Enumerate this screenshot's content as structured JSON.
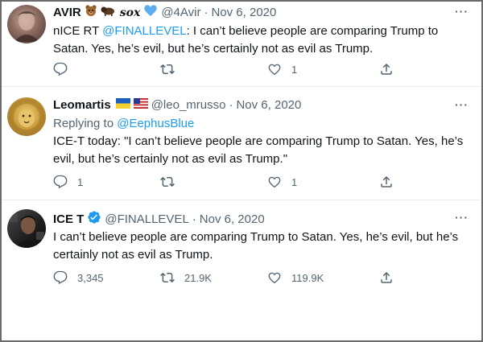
{
  "tweets": [
    {
      "display_name": "AVIR",
      "name_suffix": "sox",
      "handle": "@4Avir",
      "date": "Nov 6, 2020",
      "body_prefix": "nICE RT ",
      "body_mention": "@FINALLEVEL",
      "body_rest": ": I can’t believe people are comparing Trump to Satan.  Yes, he’s evil, but he’s certainly not as evil as Trump.",
      "replies": "",
      "retweets": "",
      "likes": "1"
    },
    {
      "display_name": "Leomartis",
      "handle": "@leo_mrusso",
      "date": "Nov 6, 2020",
      "replying_label": "Replying to ",
      "replying_mention": "@EephusBlue",
      "body": "ICE-T today: \"I can’t believe people are comparing Trump to Satan.  Yes, he’s evil, but he’s certainly not as evil as Trump.\"",
      "replies": "1",
      "retweets": "",
      "likes": "1"
    },
    {
      "display_name": "ICE T",
      "handle": "@FINALLEVEL",
      "date": "Nov 6, 2020",
      "body": "I can’t believe people are comparing Trump to Satan.  Yes, he’s evil, but he’s certainly not as evil as Trump.",
      "replies": "3,345",
      "retweets": "21.9K",
      "likes": "119.9K"
    }
  ],
  "separator": "·",
  "more_label": "···",
  "colors": {
    "link": "#1d9bf0",
    "text": "#0f1419",
    "muted": "#536471",
    "verified": "#1d9bf0"
  },
  "icons": [
    "reply-icon",
    "retweet-icon",
    "like-icon",
    "share-icon",
    "more-icon",
    "verified-badge-icon"
  ]
}
